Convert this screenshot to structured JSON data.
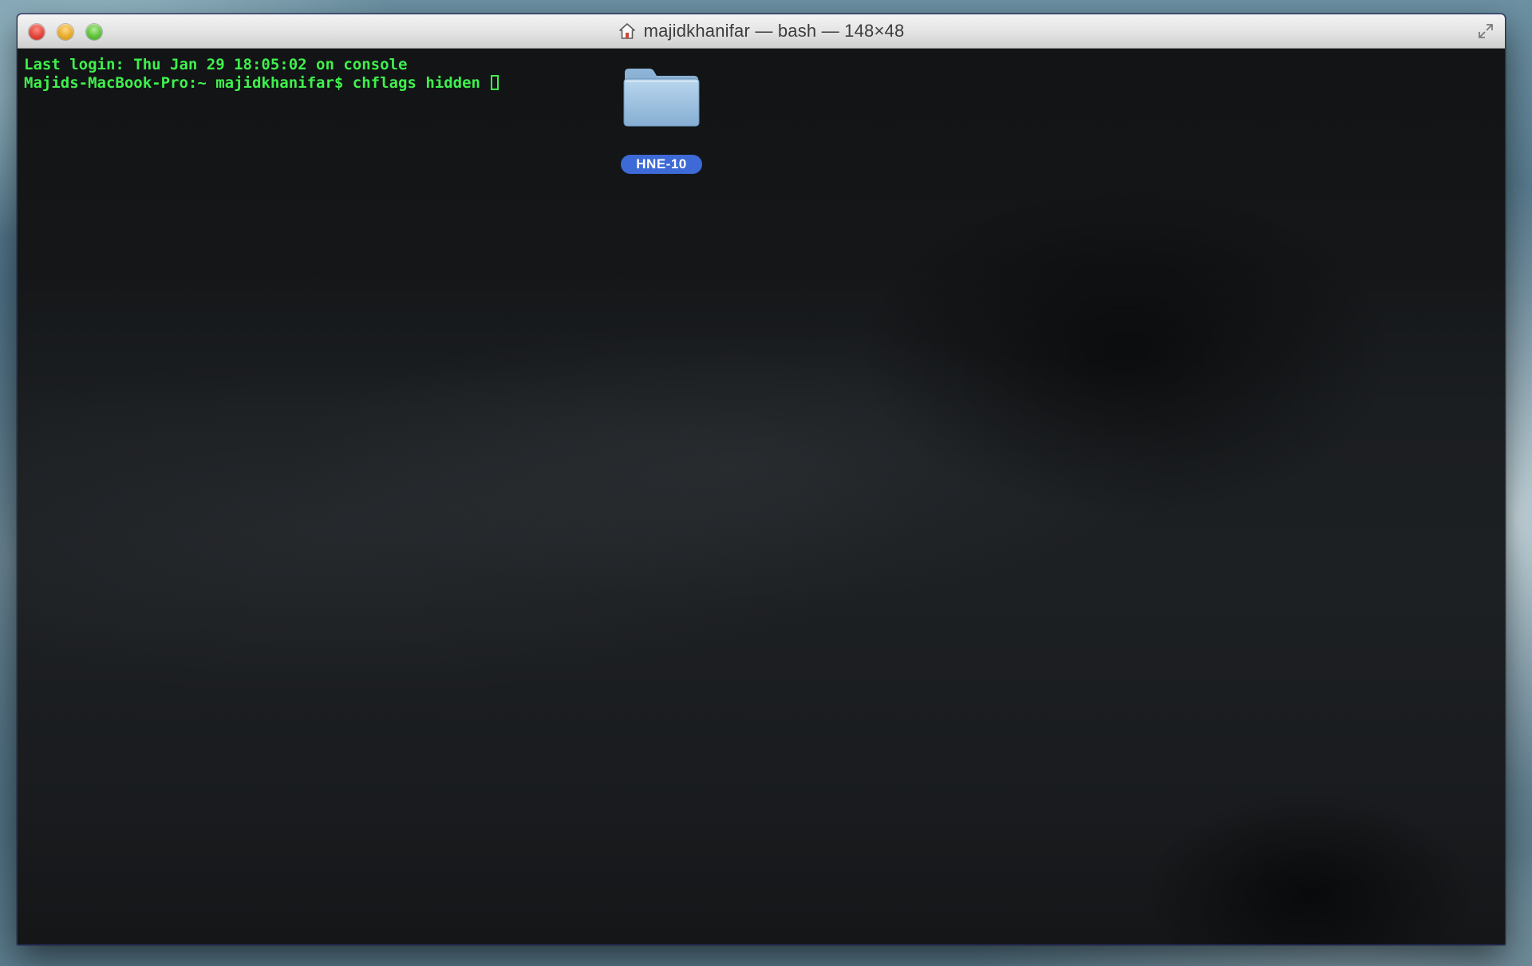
{
  "window": {
    "title": "majidkhanifar — bash — 148×48"
  },
  "terminal": {
    "lines": [
      "Last login: Thu Jan 29 18:05:02 on console",
      "Majids-MacBook-Pro:~ majidkhanifar$ chflags hidden "
    ],
    "text_color": "#3ff04c"
  },
  "desktop": {
    "folder_label": "HNE-10",
    "folder_icon": "folder-icon"
  },
  "icons": {
    "title": "home-icon",
    "fullscreen": "fullscreen-icon"
  },
  "colors": {
    "close": "#e0443a",
    "minimize": "#e8ac2a",
    "zoom": "#5ec23a",
    "selection": "#3d6ad6"
  }
}
